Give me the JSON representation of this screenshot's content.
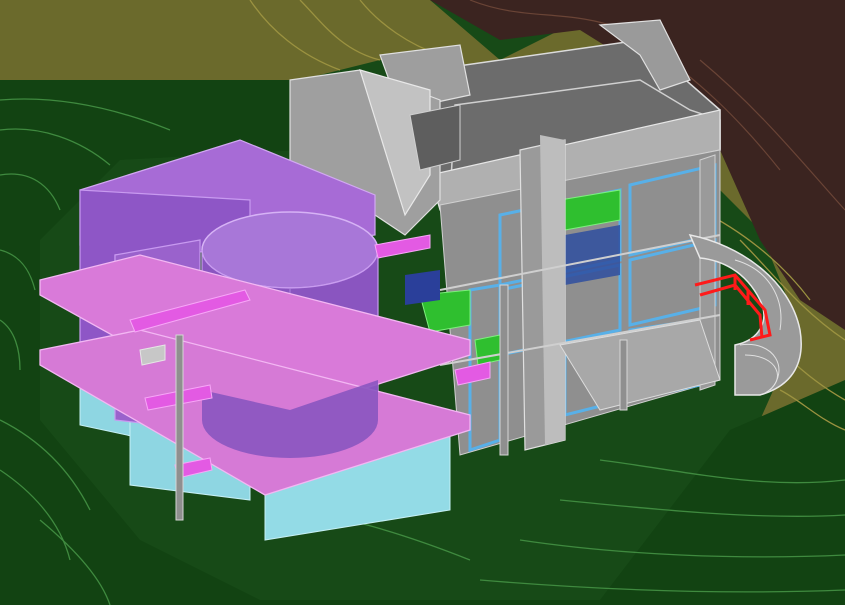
{
  "scene": {
    "description_visible_text": "",
    "colors": {
      "terrain_dark_green": "#144514",
      "terrain_line_green": "#2f7a2f",
      "terrain_olive": "#6e6b2e",
      "terrain_brown": "#3a2420",
      "building_gray": "#a9a9a9",
      "building_gray_dark": "#7d7d7d",
      "roof_dark": "#6a6a6a",
      "purple_volume": "#9966cc",
      "magenta_slab": "#d977d9",
      "cyan_wall": "#8fd7e3",
      "blue_frame": "#4fa3e0",
      "green_glass": "#2fbf2f",
      "red_stair": "#ff1a1a"
    }
  }
}
